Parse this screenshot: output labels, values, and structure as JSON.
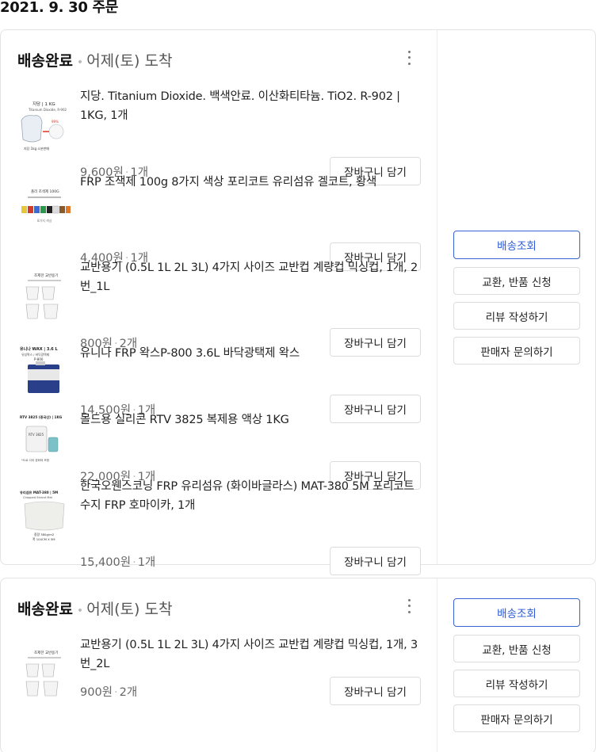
{
  "order_date": "2021. 9. 30 주문",
  "orders": [
    {
      "status": "배송완료",
      "arrival": "어제(토) 도착",
      "items": [
        {
          "title": "지당. Titanium Dioxide. 백색안료. 이산화티타늄. TiO2. R-902 | 1KG, 1개",
          "price": "9,600원",
          "qty": "1개",
          "cart_label": "장바구니 담기",
          "thumb_text": "지당 | 1 KG"
        },
        {
          "title": "FRP 조색제 100g 8가지 색상 포리코트 유리섬유 겔코트, 황색",
          "price": "4,400원",
          "qty": "1개",
          "cart_label": "장바구니 담기",
          "thumb_text": ""
        },
        {
          "title": "교반용기 (0.5L 1L 2L 3L) 4가지 사이즈 교반컵 계량컵 믹싱컵, 1개, 2번_1L",
          "price": "800원",
          "qty": "2개",
          "cart_label": "장바구니 담기",
          "thumb_text": ""
        },
        {
          "title": "유니나 FRP 왁스P-800 3.6L 바닥광택제 왁스",
          "price": "14,500원",
          "qty": "1개",
          "cart_label": "장바구니 담기",
          "thumb_text": "유니나 WAX | 3.6 L"
        },
        {
          "title": "몰드용 실리콘 RTV 3825 복제용 액상 1KG",
          "price": "22,000원",
          "qty": "1개",
          "cart_label": "장바구니 담기",
          "thumb_text": "RTV 3825 (중국산) | 1KG"
        },
        {
          "title": "한국오웬스코닝 FRP 유리섬유 (화이바글라스) MAT-380 5M 포리코트 수지 FRP 호마이카, 1개",
          "price": "15,400원",
          "qty": "1개",
          "cart_label": "장바구니 담기",
          "thumb_text": "유리섬유 MAT-380 | 5M"
        }
      ],
      "actions": {
        "track": "배송조회",
        "exchange": "교환, 반품 신청",
        "review": "리뷰 작성하기",
        "inquiry": "판매자 문의하기"
      }
    },
    {
      "status": "배송완료",
      "arrival": "어제(토) 도착",
      "items": [
        {
          "title": "교반용기 (0.5L 1L 2L 3L) 4가지 사이즈 교반컵 계량컵 믹싱컵, 1개, 3번_2L",
          "price": "900원",
          "qty": "2개",
          "cart_label": "장바구니 담기",
          "thumb_text": ""
        }
      ],
      "actions": {
        "track": "배송조회",
        "exchange": "교환, 반품 신청",
        "review": "리뷰 작성하기",
        "inquiry": "판매자 문의하기"
      }
    }
  ],
  "icons": {
    "more": "more-vertical-icon"
  },
  "colors": {
    "primary": "#2c5ad6",
    "border": "#dddddd"
  }
}
